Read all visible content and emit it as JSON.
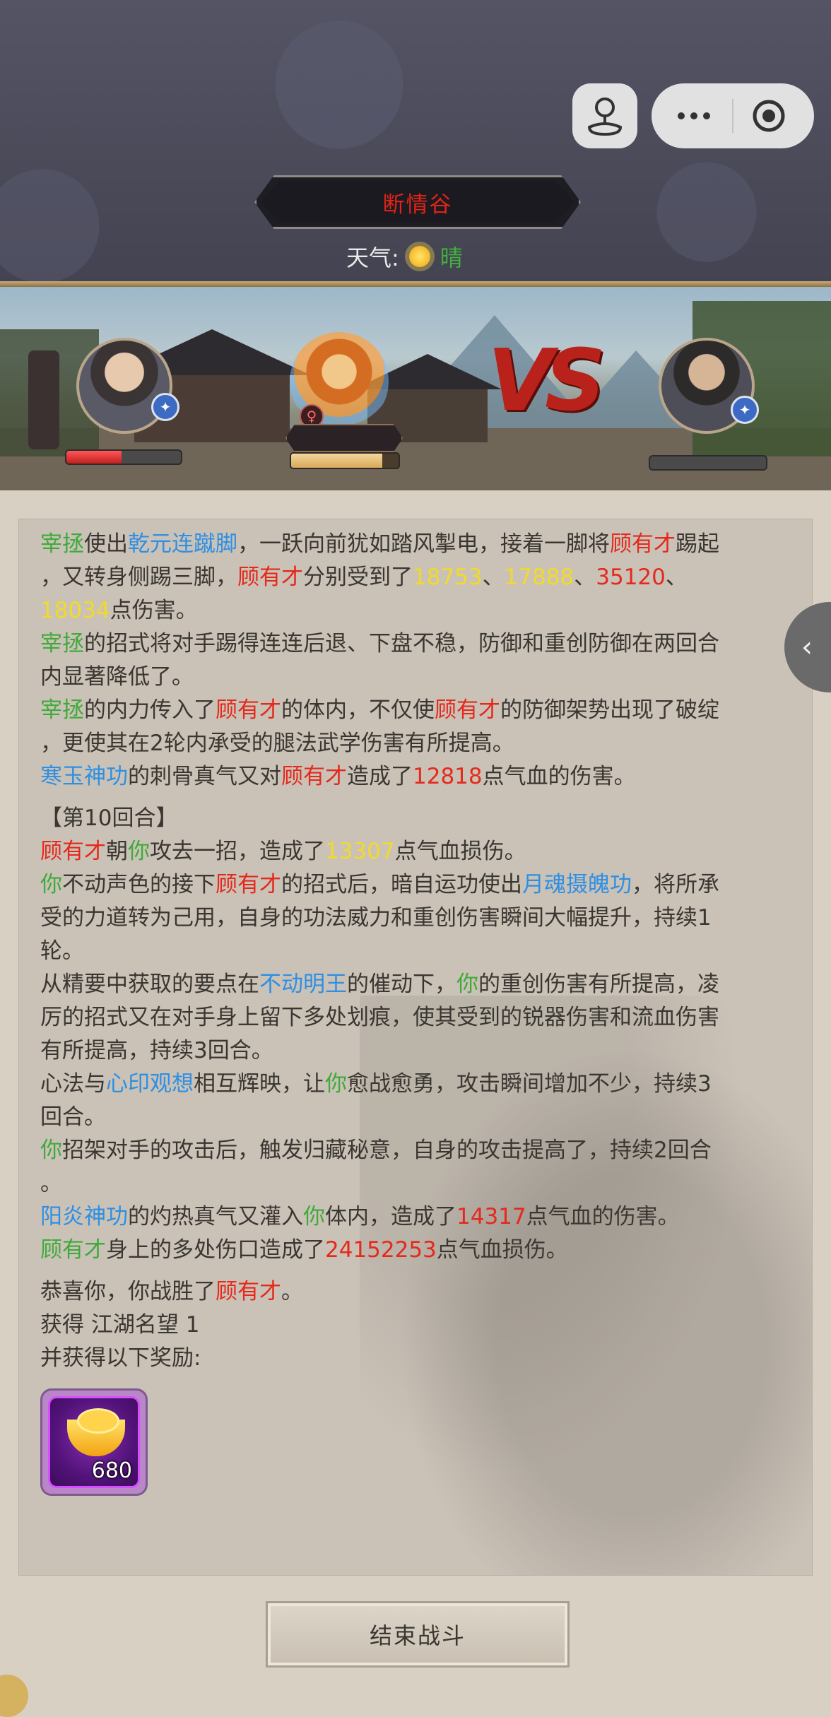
{
  "location": "断情谷",
  "weather": {
    "label": "天气:",
    "value": "晴",
    "icon": "sun-icon"
  },
  "capsule": {
    "joystick_icon": "joystick-icon",
    "more_icon": "more-icon",
    "close_icon": "record-icon"
  },
  "battle": {
    "left_hp_percent": 48,
    "npc_hp_percent": 85,
    "right_hp_percent": 0
  },
  "log": {
    "l1": {
      "a": "宰拯",
      "b": "使出",
      "c": "乾元连蹴脚",
      "d": "，一跃向前犹如踏风掣电，接着一脚将",
      "e": "顾有才",
      "f": "踢起"
    },
    "l2": {
      "a": "，又转身侧踢三脚，",
      "b": "顾有才",
      "c": "分别受到了",
      "d": "18753",
      "e": "、",
      "f": "17888",
      "g": "、",
      "h": "35120",
      "i": "、"
    },
    "l3": {
      "a": "18034",
      "b": "点伤害。"
    },
    "l4": {
      "a": "宰拯",
      "b": "的招式将对手踢得连连后退、下盘不稳，防御和重创防御在两回合"
    },
    "l5": {
      "a": "内显著降低了。"
    },
    "l6": {
      "a": "宰拯",
      "b": "的内力传入了",
      "c": "顾有才",
      "d": "的体内，不仅使",
      "e": "顾有才",
      "f": "的防御架势出现了破绽"
    },
    "l7": {
      "a": "，更使其在2轮内承受的腿法武学伤害有所提高。"
    },
    "l8": {
      "a": "寒玉神功",
      "b": "的刺骨真气又对",
      "c": "顾有才",
      "d": "造成了",
      "e": "12818",
      "f": "点气血的伤害。"
    },
    "l9": {
      "a": "【第10回合】"
    },
    "l10": {
      "a": "顾有才",
      "b": "朝",
      "c": "你",
      "d": "攻去一招，造成了",
      "e": "13307",
      "f": "点气血损伤。"
    },
    "l11": {
      "a": "你",
      "b": "不动声色的接下",
      "c": "顾有才",
      "d": "的招式后，暗自运功使出",
      "e": "月魂摄魄功",
      "f": "，将所承"
    },
    "l12": {
      "a": "受的力道转为己用，自身的功法威力和重创伤害瞬间大幅提升，持续1"
    },
    "l13": {
      "a": "轮。"
    },
    "l14": {
      "a": "从精要中获取的要点在",
      "b": "不动明王",
      "c": "的催动下，",
      "d": "你",
      "e": "的重创伤害有所提高，凌"
    },
    "l15": {
      "a": "厉的招式又在对手身上留下多处划痕，使其受到的锐器伤害和流血伤害"
    },
    "l16": {
      "a": "有所提高，持续3回合。"
    },
    "l17": {
      "a": "心法与",
      "b": "心印观想",
      "c": "相互辉映，让",
      "d": "你",
      "e": "愈战愈勇，攻击瞬间增加不少，持续3"
    },
    "l18": {
      "a": "回合。"
    },
    "l19": {
      "a": "你",
      "b": "招架对手的攻击后，触发归藏秘意，自身的攻击提高了，持续2回合"
    },
    "l20": {
      "a": "。"
    },
    "l21": {
      "a": "阳炎神功",
      "b": "的灼热真气又灌入",
      "c": "你",
      "d": "体内，造成了",
      "e": "14317",
      "f": "点气血的伤害。"
    },
    "l22": {
      "a": "顾有才",
      "b": "身上的多处伤口造成了",
      "c": "24152253",
      "d": "点气血损伤。"
    },
    "l23": {
      "a": "恭喜你，你战胜了",
      "b": "顾有才",
      "c": "。"
    },
    "l24": {
      "a": "获得 江湖名望 1"
    },
    "l25": {
      "a": "并获得以下奖励:"
    }
  },
  "reward": {
    "icon": "gold-ingot-icon",
    "count": "680"
  },
  "end_button": "结束战斗",
  "side_tab_icon": "chevron-left-icon"
}
